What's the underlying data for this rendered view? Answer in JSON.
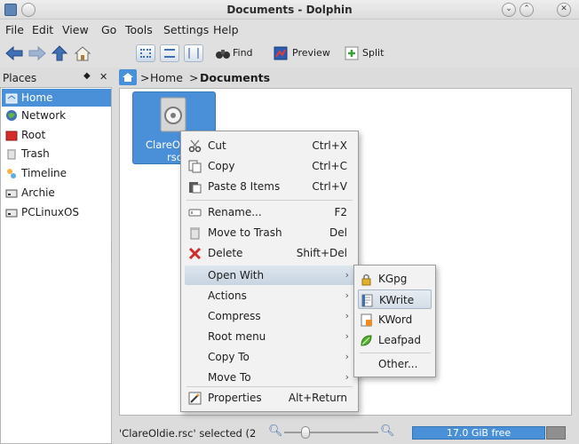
{
  "window": {
    "title": "Documents - Dolphin"
  },
  "menubar": {
    "items": [
      "File",
      "Edit",
      "View",
      "Go",
      "Tools",
      "Settings",
      "Help"
    ]
  },
  "toolbar": {
    "find": "Find",
    "preview": "Preview",
    "split": "Split"
  },
  "places": {
    "header": "Places",
    "items": [
      "Home",
      "Network",
      "Root",
      "Trash",
      "Timeline",
      "Archie",
      "PCLinuxOS"
    ],
    "selected": "Home"
  },
  "breadcrumb": {
    "home": "Home",
    "separator": ">",
    "current": "Documents"
  },
  "file": {
    "name_line1": "ClareO",
    "name_line2": "rsc"
  },
  "context_menu": {
    "items": [
      {
        "label": "Cut",
        "shortcut": "Ctrl+X"
      },
      {
        "label": "Copy",
        "shortcut": "Ctrl+C"
      },
      {
        "label": "Paste 8 Items",
        "shortcut": "Ctrl+V"
      },
      {
        "label": "Rename...",
        "shortcut": "F2"
      },
      {
        "label": "Move to Trash",
        "shortcut": "Del"
      },
      {
        "label": "Delete",
        "shortcut": "Shift+Del"
      },
      {
        "label": "Open With"
      },
      {
        "label": "Actions"
      },
      {
        "label": "Compress"
      },
      {
        "label": "Root menu"
      },
      {
        "label": "Copy To"
      },
      {
        "label": "Move To"
      },
      {
        "label": "Properties",
        "shortcut": "Alt+Return"
      }
    ]
  },
  "submenu": {
    "items": [
      "KGpg",
      "KWrite",
      "KWord",
      "Leafpad",
      "Other..."
    ]
  },
  "statusbar": {
    "message": "'ClareOldie.rsc' selected (2",
    "free_space": "17.0 GiB free",
    "zoom_fraction": 0.2
  },
  "colors": {
    "selection": "#4a90d9",
    "menu_highlight": "#c8d4e1"
  }
}
